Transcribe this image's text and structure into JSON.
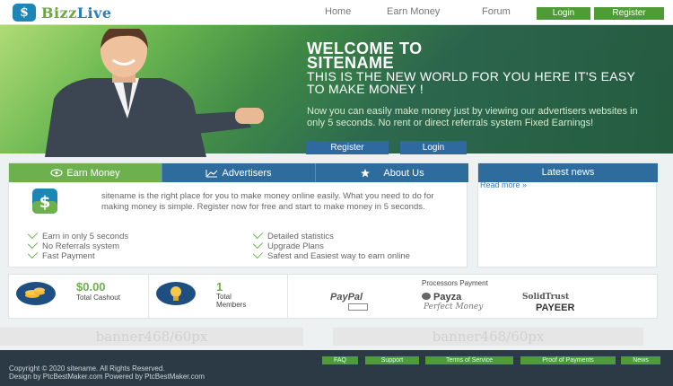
{
  "header": {
    "logo_part1": "Bizz",
    "logo_part2": "Live",
    "nav": [
      "Home",
      "Earn Money",
      "Forum"
    ],
    "login": "Login",
    "register": "Register"
  },
  "hero": {
    "title_line1": "WELCOME TO",
    "title_line2": "SITENAME",
    "subtitle": "THIS IS THE NEW WORLD FOR YOU HERE IT'S EASY TO MAKE MONEY !",
    "desc": "Now you can easily make money just by viewing our advertisers websites in only 5 seconds. No rent or direct referrals system Fixed Earnings!",
    "register": "Register",
    "login": "Login"
  },
  "tabs": [
    "Earn Money",
    "Advertisers",
    "About Us"
  ],
  "panel": {
    "text": "sitename is the right place for you to make money online easily. What you need to do for making money is simple. Register now for free and start to make money in 5 seconds.",
    "features_left": [
      "Earn in only 5 seconds",
      "No Referrals system",
      "Fast Payment"
    ],
    "features_right": [
      "Detailed statistics",
      "Upgrade Plans",
      "Safest and Easiest way to earn online"
    ]
  },
  "news": {
    "title": "Latest news",
    "more": "Read more »"
  },
  "stats": {
    "cashout_value": "$0.00",
    "cashout_label": "Total Cashout",
    "members_value": "1",
    "members_label": "Total Members",
    "processors_title": "Processors Payment",
    "processors": [
      "PayPal",
      "Payza",
      "SolidTrust",
      "PAYEER",
      "Perfect Money"
    ]
  },
  "banners": [
    "banner468/60px",
    "banner468/60px"
  ],
  "footer": {
    "links": [
      "FAQ",
      "Support",
      "Terms of Service",
      "Proof of Payments",
      "News"
    ],
    "copyright": "Copyright © 2020 sitename. All Rights Reserved.",
    "credits": "Design by PtcBestMaker.com Powered by PtcBestMaker.com"
  },
  "colors": {
    "green": "#4f9c36",
    "blue": "#2d6c9d",
    "footer": "#2b3a45"
  }
}
